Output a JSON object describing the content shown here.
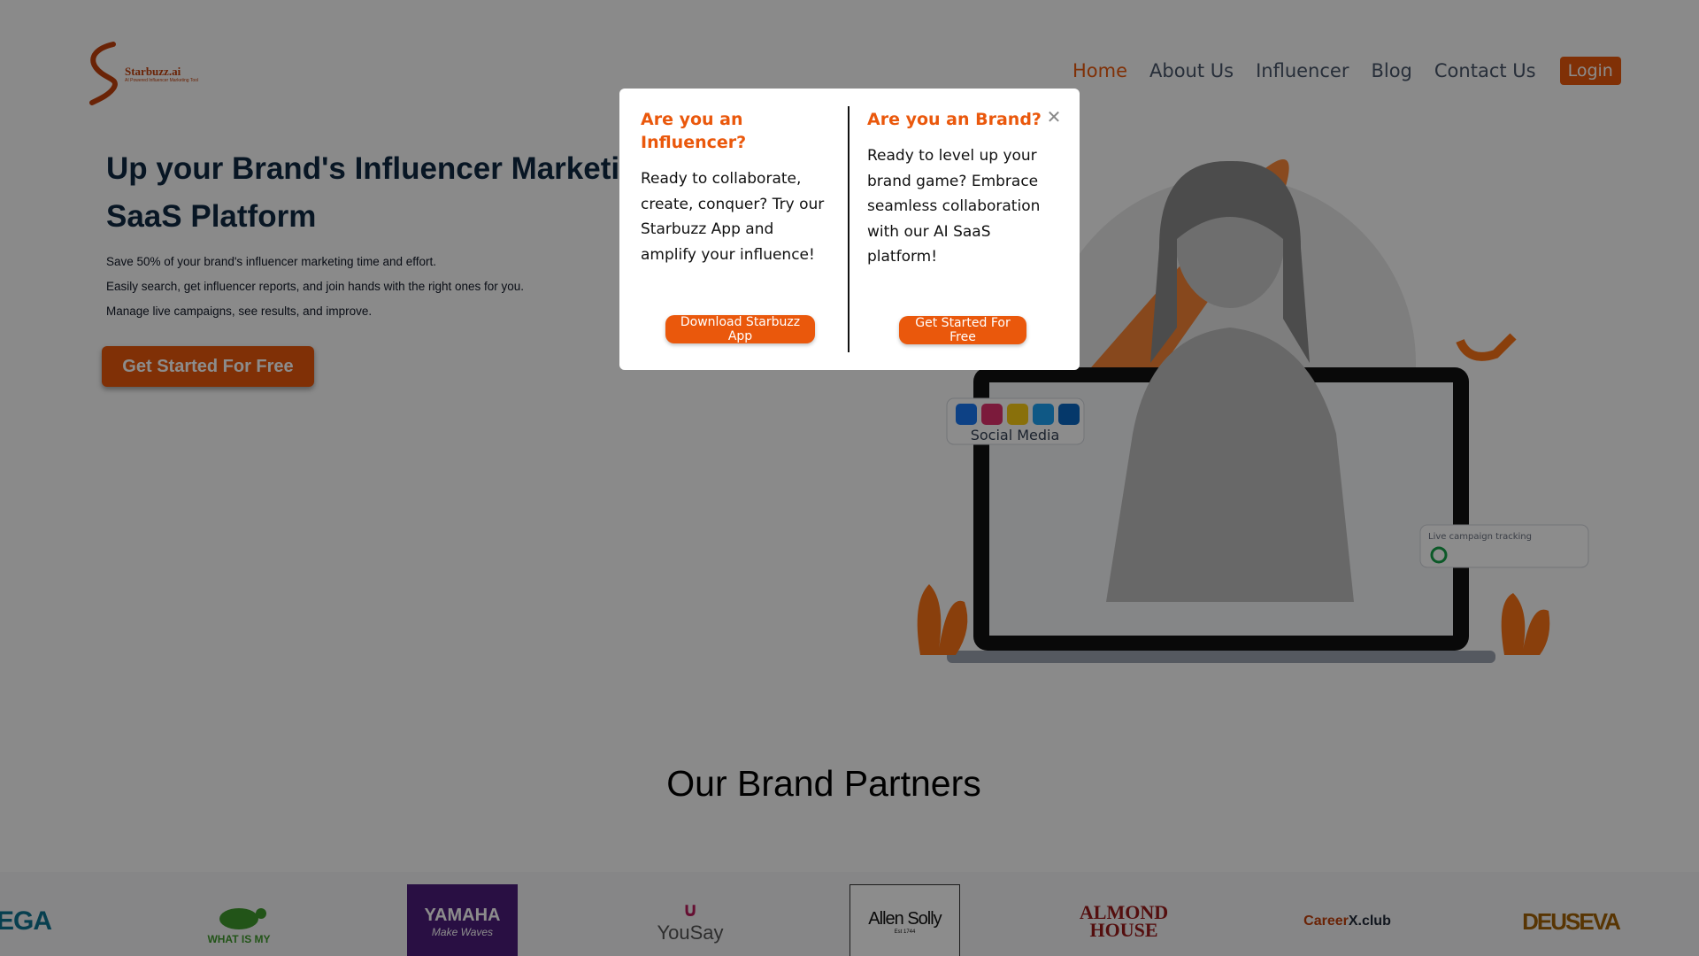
{
  "brand": {
    "name": "Starbuzz.ai",
    "tagline": "AI Powered Influencer Marketing Tool",
    "accent": "#ea580c"
  },
  "nav": {
    "items": [
      {
        "label": "Home",
        "active": true
      },
      {
        "label": "About Us",
        "active": false
      },
      {
        "label": "Influencer",
        "active": false
      },
      {
        "label": "Blog",
        "active": false
      },
      {
        "label": "Contact Us",
        "active": false
      }
    ],
    "login": "Login"
  },
  "hero": {
    "title_line1": "Up your Brand's Influencer Marketing",
    "title_line2": "SaaS Platform",
    "lines": [
      "Save 50% of your brand's influencer marketing time and effort.",
      "Easily search, get influencer reports, and join hands with the right ones for you.",
      "Manage live campaigns, see results, and improve."
    ],
    "cta": "Get Started For Free",
    "social_label": "Social Media",
    "tracking_label": "Live campaign tracking"
  },
  "partners": {
    "title": "Our Brand Partners",
    "logos": {
      "vega": "EGA",
      "wim": "WHAT IS MY",
      "yamaha": "YAMAHA",
      "yamaha_sub": "Make Waves",
      "yousay": "YouSay",
      "allen": "Allen Solly",
      "allen_sub": "Est 1744",
      "almond1": "ALMOND",
      "almond2": "HOUSE",
      "career1": "Career",
      "career2": "X.club",
      "deuseva": "DEUSEVA"
    }
  },
  "modal": {
    "influencer": {
      "heading": "Are you an Influencer?",
      "body": "Ready to collaborate, create, conquer? Try our Starbuzz App and amplify your influence!",
      "button": "Download Starbuzz App"
    },
    "brand": {
      "heading": "Are you an Brand?",
      "body": "Ready to level up your brand game? Embrace seamless collaboration with our AI SaaS platform!",
      "button": "Get Started For Free"
    },
    "close_icon": "close-icon"
  }
}
